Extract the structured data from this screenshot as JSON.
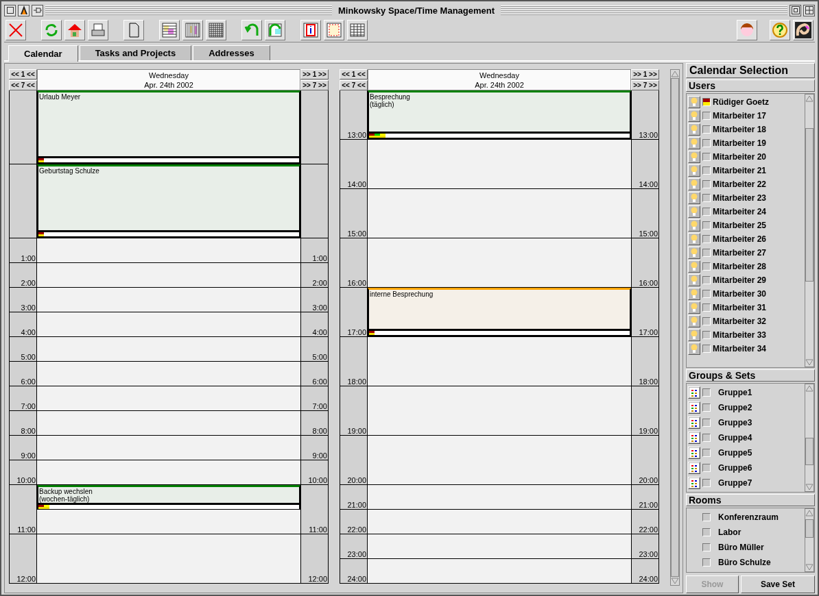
{
  "window": {
    "title": "Minkowsky Space/Time Management"
  },
  "tabs": [
    {
      "label": "Calendar",
      "selected": true
    },
    {
      "label": "Tasks and Projects",
      "selected": false
    },
    {
      "label": "Addresses",
      "selected": false
    }
  ],
  "days": [
    {
      "nav_back": [
        "<< 1 <<",
        "<< 7 <<"
      ],
      "nav_forward": [
        ">> 1 >>",
        ">> 7 >>"
      ],
      "weekday": "Wednesday",
      "date": "Apr. 24th 2002",
      "rows": [
        {
          "event": {
            "title": "Urlaub Meyer",
            "color": "#008000",
            "markers": [
              {
                "color": "#a00000"
              }
            ]
          }
        },
        {
          "event": {
            "title": "Geburtstag Schulze",
            "color": "#008000",
            "markers": [
              {
                "color": "#a00000"
              }
            ]
          }
        },
        {
          "time_left": "1:00",
          "time_right": "1:00"
        },
        {
          "time_left": "2:00",
          "time_right": "2:00"
        },
        {
          "time_left": "3:00",
          "time_right": "3:00"
        },
        {
          "time_left": "4:00",
          "time_right": "4:00"
        },
        {
          "time_left": "5:00",
          "time_right": "5:00"
        },
        {
          "time_left": "6:00",
          "time_right": "6:00"
        },
        {
          "time_left": "7:00",
          "time_right": "7:00"
        },
        {
          "time_left": "8:00",
          "time_right": "8:00"
        },
        {
          "time_left": "9:00",
          "time_right": "9:00"
        },
        {
          "time_left": "10:00",
          "time_right": "10:00"
        },
        {
          "event": {
            "title": "Backup wechslen\n(wochen-täglich)",
            "color": "#008000",
            "markers": [
              {
                "color": "#a00000"
              },
              {
                "color": "#ffff00"
              }
            ]
          }
        },
        {
          "time_left": "11:00",
          "time_right": "11:00"
        },
        {
          "time_left": "12:00",
          "time_right": "12:00"
        }
      ]
    },
    {
      "nav_back": [
        "<< 1 <<",
        "<< 7 <<"
      ],
      "nav_forward": [
        ">> 1 >>",
        ">> 7 >>"
      ],
      "weekday": "Wednesday",
      "date": "Apr. 24th 2002",
      "rows": [
        {
          "time_left": "13:00",
          "time_right": "13:00",
          "event": {
            "title": "Besprechung\n(täglich)",
            "color": "#008000",
            "markers": [
              {
                "color": "#a00000"
              },
              {
                "color": "#00d000"
              },
              {
                "color": "#ffff00"
              }
            ]
          }
        },
        {
          "time_left": "14:00",
          "time_right": "14:00"
        },
        {
          "time_left": "15:00",
          "time_right": "15:00"
        },
        {
          "time_left": "16:00",
          "time_right": "16:00"
        },
        {
          "time_left": "17:00",
          "time_right": "17:00",
          "event": {
            "title": "interne Besprechung",
            "color": "#ffa500",
            "markers": [
              {
                "color": "#a00000"
              }
            ]
          }
        },
        {
          "time_left": "18:00",
          "time_right": "18:00"
        },
        {
          "time_left": "19:00",
          "time_right": "19:00"
        },
        {
          "time_left": "20:00",
          "time_right": "20:00"
        },
        {
          "time_left": "21:00",
          "time_right": "21:00"
        },
        {
          "time_left": "22:00",
          "time_right": "22:00"
        },
        {
          "time_left": "23:00",
          "time_right": "23:00"
        },
        {
          "time_left": "24:00",
          "time_right": "24:00"
        }
      ]
    }
  ],
  "selection": {
    "title": "Calendar Selection",
    "users": {
      "title": "Users",
      "items": [
        {
          "name": "Rüdiger Goetz",
          "checked": true
        },
        {
          "name": "Mitarbeiter 17",
          "checked": false
        },
        {
          "name": "Mitarbeiter 18",
          "checked": false
        },
        {
          "name": "Mitarbeiter 19",
          "checked": false
        },
        {
          "name": "Mitarbeiter 20",
          "checked": false
        },
        {
          "name": "Mitarbeiter 21",
          "checked": false
        },
        {
          "name": "Mitarbeiter 22",
          "checked": false
        },
        {
          "name": "Mitarbeiter 23",
          "checked": false
        },
        {
          "name": "Mitarbeiter 24",
          "checked": false
        },
        {
          "name": "Mitarbeiter 25",
          "checked": false
        },
        {
          "name": "Mitarbeiter 26",
          "checked": false
        },
        {
          "name": "Mitarbeiter 27",
          "checked": false
        },
        {
          "name": "Mitarbeiter 28",
          "checked": false
        },
        {
          "name": "Mitarbeiter 29",
          "checked": false
        },
        {
          "name": "Mitarbeiter 30",
          "checked": false
        },
        {
          "name": "Mitarbeiter 31",
          "checked": false
        },
        {
          "name": "Mitarbeiter 32",
          "checked": false
        },
        {
          "name": "Mitarbeiter 33",
          "checked": false
        },
        {
          "name": "Mitarbeiter 34",
          "checked": false
        }
      ]
    },
    "groups": {
      "title": "Groups & Sets",
      "items": [
        {
          "name": "Gruppe1",
          "checked": false
        },
        {
          "name": "Gruppe2",
          "checked": false
        },
        {
          "name": "Gruppe3",
          "checked": false
        },
        {
          "name": "Gruppe4",
          "checked": false
        },
        {
          "name": "Gruppe5",
          "checked": false
        },
        {
          "name": "Gruppe6",
          "checked": false
        },
        {
          "name": "Gruppe7",
          "checked": false
        }
      ]
    },
    "rooms": {
      "title": "Rooms",
      "items": [
        {
          "name": "Konferenzraum",
          "checked": false
        },
        {
          "name": "Labor",
          "checked": false
        },
        {
          "name": "Büro Müller",
          "checked": false
        },
        {
          "name": "Büro Schulze",
          "checked": false
        }
      ]
    },
    "buttons": [
      {
        "label": "Show",
        "disabled": true
      },
      {
        "label": "Save Set",
        "disabled": false
      }
    ]
  }
}
